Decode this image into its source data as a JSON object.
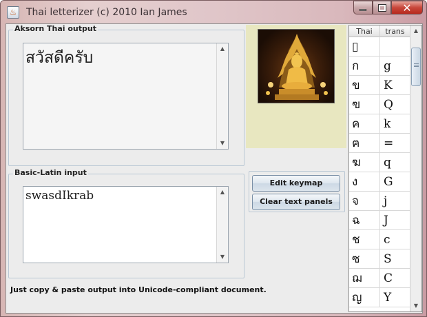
{
  "window": {
    "title": "Thai letterizer (c) 2010 Ian James",
    "minimize_glyph": "",
    "maximize_glyph": "",
    "close_glyph": "✕"
  },
  "output_panel": {
    "title": "Aksorn Thai output",
    "text": "สวัสดีครับ"
  },
  "input_panel": {
    "title": "Basic-Latin input",
    "text": "swasdIkrab"
  },
  "buttons": {
    "edit_keymap": "Edit keymap",
    "clear_panels": "Clear text panels"
  },
  "status_text": "Just copy & paste output into Unicode-compliant document.",
  "keymap_table": {
    "headers": [
      "Thai",
      "trans"
    ],
    "rows": [
      [
        "▯",
        ""
      ],
      [
        "ก",
        "g"
      ],
      [
        "ข",
        "K"
      ],
      [
        "ฃ",
        "Q"
      ],
      [
        "ค",
        "k"
      ],
      [
        "ฅ",
        "="
      ],
      [
        "ฆ",
        "q"
      ],
      [
        "ง",
        "G"
      ],
      [
        "จ",
        "j"
      ],
      [
        "ฉ",
        "J"
      ],
      [
        "ช",
        "c"
      ],
      [
        "ซ",
        "S"
      ],
      [
        "ฌ",
        "C"
      ],
      [
        "ญ",
        "Y"
      ]
    ]
  },
  "colors": {
    "image_panel_bg": "#e8e7c0",
    "accent": "#7a8fa6"
  }
}
